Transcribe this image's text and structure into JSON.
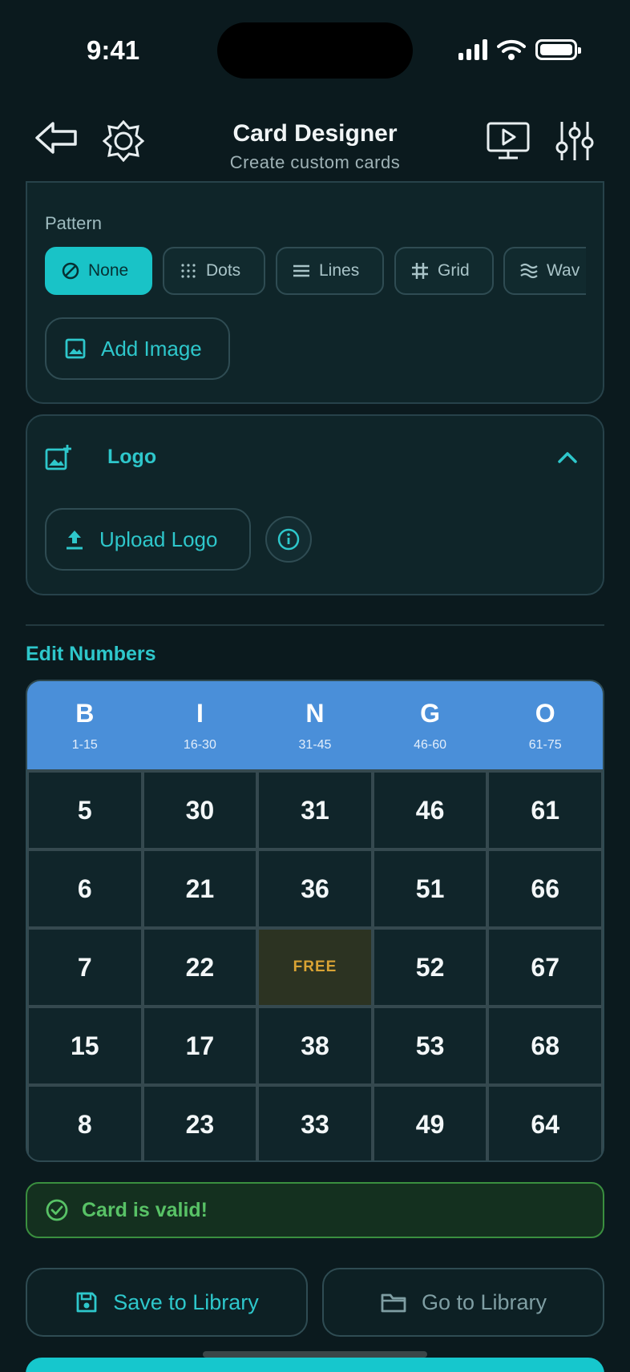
{
  "status": {
    "time": "9:41"
  },
  "header": {
    "title": "Card Designer",
    "subtitle": "Create custom cards"
  },
  "pattern": {
    "label": "Pattern",
    "chips": [
      "None",
      "Dots",
      "Lines",
      "Grid",
      "Wav"
    ],
    "selected": "None",
    "add_image": "Add Image"
  },
  "logo": {
    "title": "Logo",
    "upload": "Upload Logo"
  },
  "numbers": {
    "title": "Edit Numbers",
    "columns": [
      {
        "letter": "B",
        "range": "1-15"
      },
      {
        "letter": "I",
        "range": "16-30"
      },
      {
        "letter": "N",
        "range": "31-45"
      },
      {
        "letter": "G",
        "range": "46-60"
      },
      {
        "letter": "O",
        "range": "61-75"
      }
    ],
    "rows": [
      [
        "5",
        "30",
        "31",
        "46",
        "61"
      ],
      [
        "6",
        "21",
        "36",
        "51",
        "66"
      ],
      [
        "7",
        "22",
        "FREE",
        "52",
        "67"
      ],
      [
        "15",
        "17",
        "38",
        "53",
        "68"
      ],
      [
        "8",
        "23",
        "33",
        "49",
        "64"
      ]
    ]
  },
  "validation": {
    "message": "Card is valid!"
  },
  "actions": {
    "save": "Save to Library",
    "go": "Go to Library"
  },
  "colors": {
    "accent": "#19c3c7",
    "header_blue": "#4a8fd9",
    "valid_green": "#58c266",
    "free_gold": "#d9a334"
  }
}
